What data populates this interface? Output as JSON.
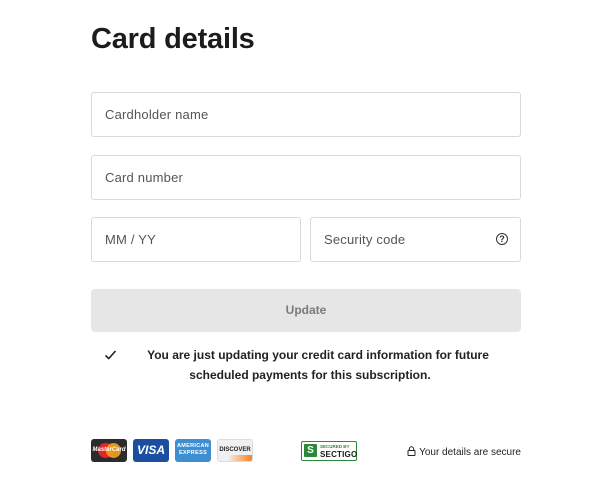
{
  "header": {
    "title": "Card details"
  },
  "form": {
    "cardholder_placeholder": "Cardholder name",
    "card_number_placeholder": "Card number",
    "expiry_placeholder": "MM / YY",
    "security_code_placeholder": "Security code",
    "security_help_icon": "question-circle-icon"
  },
  "actions": {
    "update_label": "Update"
  },
  "note": {
    "icon": "checkmark-icon",
    "text": "You are just updating your credit card information for future scheduled payments for this subscription."
  },
  "footer": {
    "card_brands": {
      "mastercard": "MasterCard",
      "visa": "VISA",
      "amex": "AMERICAN EXPRESS",
      "discover": "DISCOVER"
    },
    "badge": {
      "top": "SECURED BY",
      "main": "SECTIGO",
      "icon": "S"
    },
    "secure_text": "Your details are secure",
    "secure_icon": "lock-icon"
  },
  "colors": {
    "button_bg": "#e6e6e6",
    "button_text": "#7a7a7a",
    "sectigo_green": "#2a8a3a",
    "visa_blue": "#1a4fa0",
    "amex_blue": "#3d8fd1"
  }
}
